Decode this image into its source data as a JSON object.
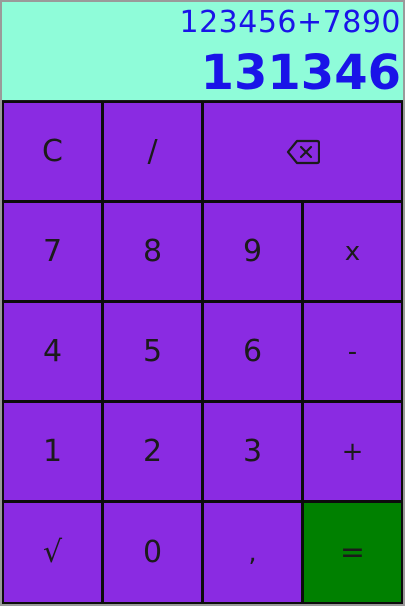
{
  "display": {
    "expression": "123456+7890",
    "result": "131346"
  },
  "keys": {
    "clear": "C",
    "divide": "/",
    "seven": "7",
    "eight": "8",
    "nine": "9",
    "multiply": "x",
    "four": "4",
    "five": "5",
    "six": "6",
    "minus": "-",
    "one": "1",
    "two": "2",
    "three": "3",
    "plus": "+",
    "sqrt": "√",
    "zero": "0",
    "comma": ",",
    "equals": "="
  },
  "icons": {
    "backspace": "backspace-icon"
  },
  "colors": {
    "display_background": "#8ffcd9",
    "display_text": "#1a14e8",
    "key_background": "#8a2be2",
    "equals_background": "#008000",
    "key_text": "#1b1b1b"
  }
}
